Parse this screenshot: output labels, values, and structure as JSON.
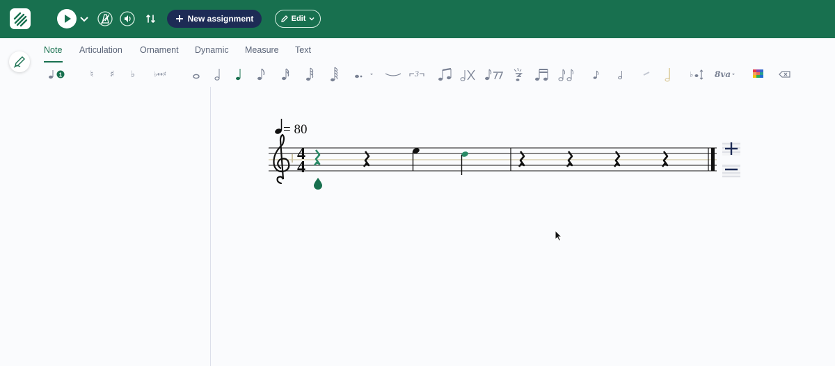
{
  "header": {
    "new_assignment_label": "New assignment",
    "edit_label": "Edit",
    "icons": [
      "logo-icon",
      "play-icon",
      "chevron-down-icon",
      "metronome-icon",
      "speaker-icon",
      "input-icon",
      "plus-icon",
      "pencil-icon"
    ]
  },
  "tabs": [
    {
      "label": "Note",
      "active": true
    },
    {
      "label": "Articulation",
      "active": false
    },
    {
      "label": "Ornament",
      "active": false
    },
    {
      "label": "Dynamic",
      "active": false
    },
    {
      "label": "Measure",
      "active": false
    },
    {
      "label": "Text",
      "active": false
    }
  ],
  "toolbar": {
    "voice_badge": "1",
    "tuplet_label": "3",
    "ottava_label": "8va"
  },
  "score": {
    "tempo_value": "= 80",
    "time_signature_top": "4",
    "time_signature_bottom": "4"
  },
  "colors": {
    "header_bg": "#18704f",
    "accent": "#18704f",
    "button_dark": "#1d2b55",
    "selected_note": "#2a8a66"
  }
}
